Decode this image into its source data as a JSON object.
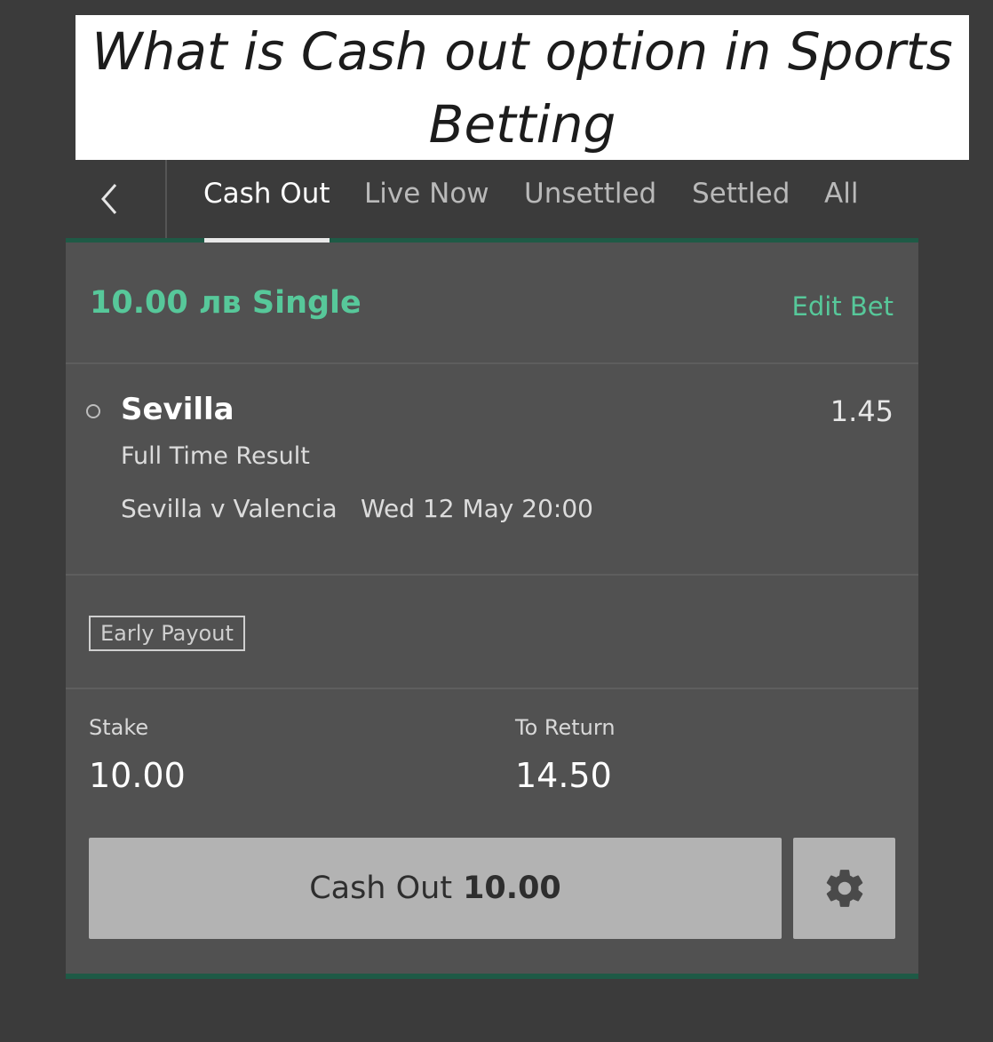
{
  "banner": {
    "title": "What is Cash out option in Sports\nBetting"
  },
  "nav": {
    "tabs": [
      {
        "label": "Cash Out",
        "active": true
      },
      {
        "label": "Live Now",
        "active": false
      },
      {
        "label": "Unsettled",
        "active": false
      },
      {
        "label": "Settled",
        "active": false
      },
      {
        "label": "All",
        "active": false
      }
    ]
  },
  "bet": {
    "title": "10.00 лв Single",
    "edit_label": "Edit Bet",
    "selection": "Sevilla",
    "odds": "1.45",
    "market": "Full Time Result",
    "match": "Sevilla v Valencia",
    "match_time": "Wed 12 May 20:00",
    "badge": "Early Payout",
    "stake_label": "Stake",
    "stake_value": "10.00",
    "return_label": "To Return",
    "return_value": "14.50",
    "cashout_label": "Cash Out",
    "cashout_amount": "10.00"
  },
  "colors": {
    "accent_green": "#57c89a",
    "panel_bg": "#515151",
    "page_bg": "#3b3b3b",
    "button_bg": "#b3b3b3"
  },
  "icons": {
    "back": "chevron-left-icon",
    "settings": "gear-icon",
    "selection_marker": "radio-circle-icon"
  }
}
